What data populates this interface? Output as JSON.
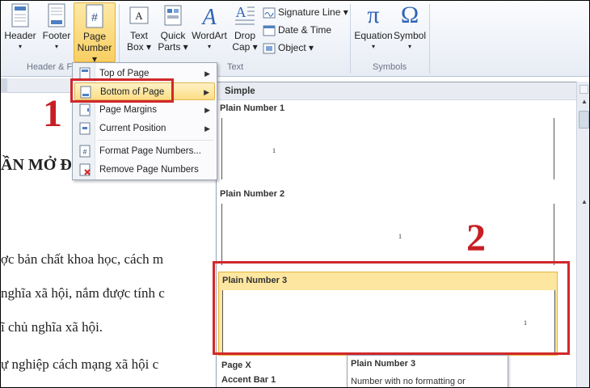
{
  "ribbon": {
    "header": "Header",
    "footer": "Footer",
    "page_number_line1": "Page",
    "page_number_line2": "Number ▾",
    "group_header_footer": "Header & F",
    "text_box_line1": "Text",
    "text_box_line2": "Box ▾",
    "quick_parts_line1": "Quick",
    "quick_parts_line2": "Parts ▾",
    "wordart": "WordArt",
    "drop_cap_line1": "Drop",
    "drop_cap_line2": "Cap ▾",
    "signature_line": "Signature Line ▾",
    "date_time": "Date & Time",
    "object": "Object ▾",
    "group_text": "Text",
    "equation": "Equation",
    "symbol": "Symbol",
    "group_symbols": "Symbols"
  },
  "menu": {
    "items": [
      {
        "label": "Top of Page"
      },
      {
        "label": "Bottom of Page"
      },
      {
        "label": "Page Margins"
      },
      {
        "label": "Current Position"
      },
      {
        "label": "Format Page Numbers..."
      },
      {
        "label": "Remove Page Numbers"
      }
    ]
  },
  "gallery": {
    "header": "Simple",
    "pn1": "Plain Number 1",
    "pn2": "Plain Number 2",
    "pn3": "Plain Number 3",
    "digit": "1",
    "page_x": "Page X",
    "accent_bar": "Accent Bar 1"
  },
  "tooltip": {
    "title": "Plain Number 3",
    "desc": "Number with no formatting or"
  },
  "doc": {
    "heading": "ẦN MỞ ĐẦU",
    "line1": "ợc bản chất khoa học, cách m",
    "line2": "nghĩa xã hội, nắm được tính c",
    "line3": "ĩ chủ nghĩa xã hội.",
    "line4": "ự nghiệp cách mạng xã hội c"
  },
  "annotations": {
    "step1": "1",
    "step2": "2"
  },
  "colors": {
    "highlight": "#d1282b",
    "menu_hover": "#fbdd85",
    "selection": "#fde6a0"
  }
}
